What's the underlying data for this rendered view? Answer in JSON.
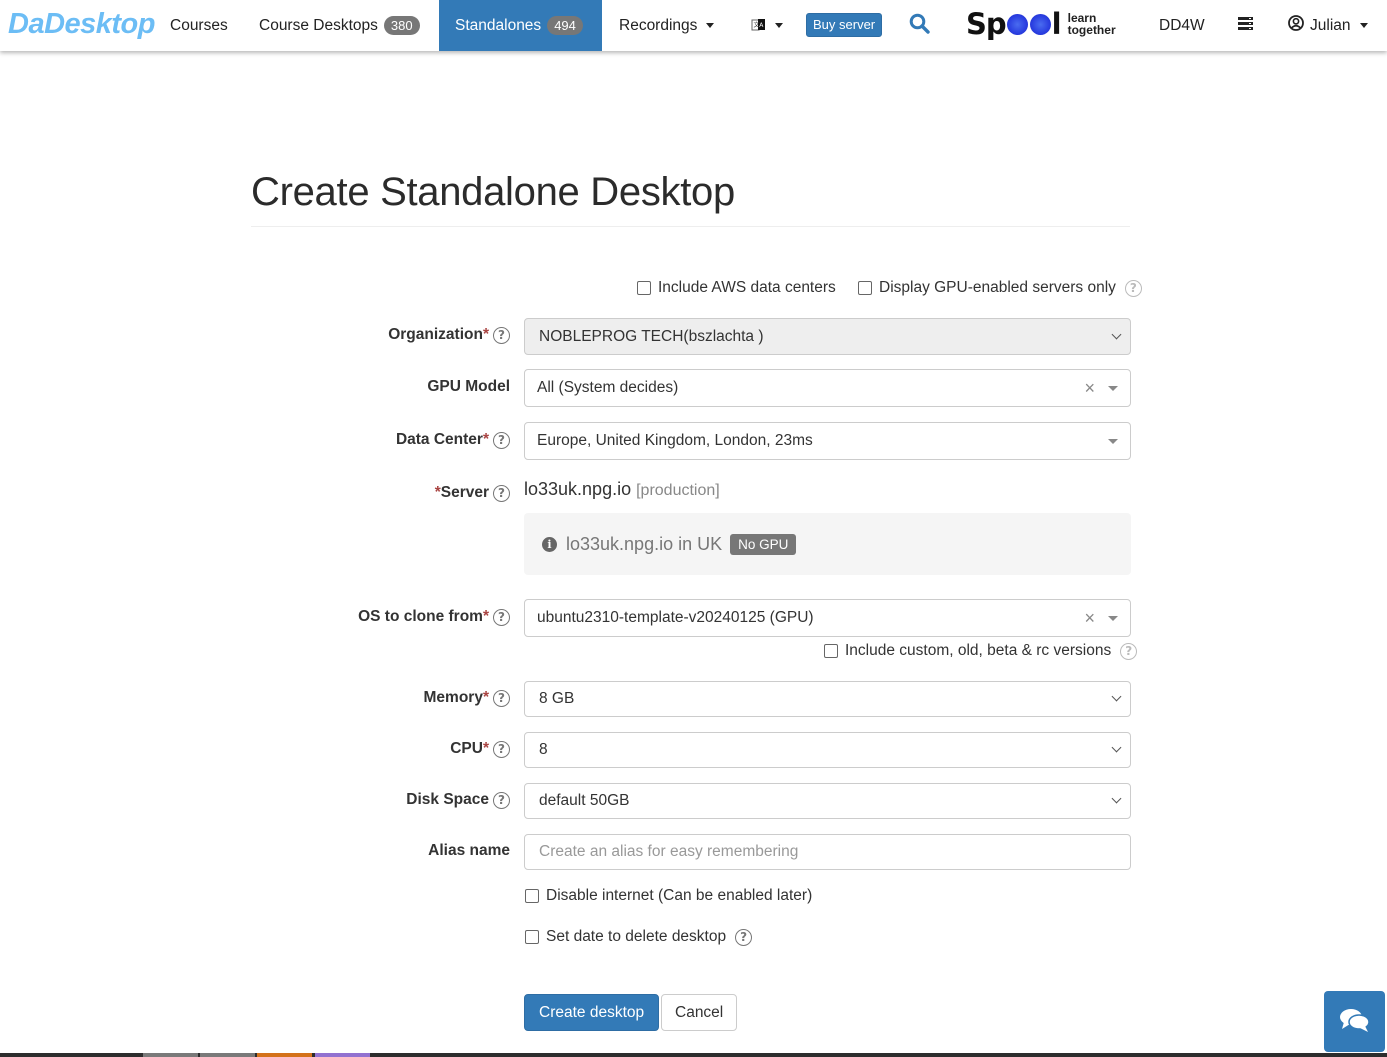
{
  "navbar": {
    "brand": "DaDesktop",
    "items": [
      {
        "label": "Courses"
      },
      {
        "label": "Course Desktops",
        "badge": "380"
      },
      {
        "label": "Standalones",
        "badge": "494",
        "active": true
      },
      {
        "label": "Recordings"
      }
    ],
    "buy_server": "Buy server",
    "spool": {
      "word_start": "Sp",
      "word_end": "l",
      "tagline_1": "learn",
      "tagline_2": "together"
    },
    "dd4w": "DD4W",
    "user": "Julian"
  },
  "page": {
    "title": "Create Standalone Desktop"
  },
  "filters": {
    "aws": {
      "label": "Include AWS data centers",
      "checked": false
    },
    "gpu_only": {
      "label": "Display GPU-enabled servers only",
      "checked": false
    }
  },
  "form": {
    "organization": {
      "label": "Organization",
      "value": "NOBLEPROG TECH(bszlachta )"
    },
    "gpu_model": {
      "label": "GPU Model",
      "value": "All (System decides)"
    },
    "data_center": {
      "label": "Data Center",
      "value": "Europe, United Kingdom, London, 23ms"
    },
    "server": {
      "label": "Server",
      "value": "lo33uk.npg.io",
      "env": "[production]",
      "info": "lo33uk.npg.io in UK",
      "gpu_badge": "No GPU"
    },
    "os": {
      "label": "OS to clone from",
      "value": "ubuntu2310-template-v20240125 (GPU)",
      "include_versions": {
        "label": "Include custom, old, beta & rc versions",
        "checked": false
      }
    },
    "memory": {
      "label": "Memory",
      "value": "8 GB"
    },
    "cpu": {
      "label": "CPU",
      "value": "8"
    },
    "disk": {
      "label": "Disk Space",
      "value": "default 50GB"
    },
    "alias": {
      "label": "Alias name",
      "value": "",
      "placeholder": "Create an alias for easy remembering"
    },
    "disable_internet": {
      "label": "Disable internet (Can be enabled later)",
      "checked": false
    },
    "delete_date": {
      "label": "Set date to delete desktop",
      "checked": false
    },
    "required_mark": "*",
    "help_glyph": "?"
  },
  "actions": {
    "create": "Create desktop",
    "cancel": "Cancel"
  },
  "colors": {
    "primary": "#337ab7",
    "brand": "#6cbdf5",
    "badge": "#777777",
    "required": "#a94442"
  }
}
